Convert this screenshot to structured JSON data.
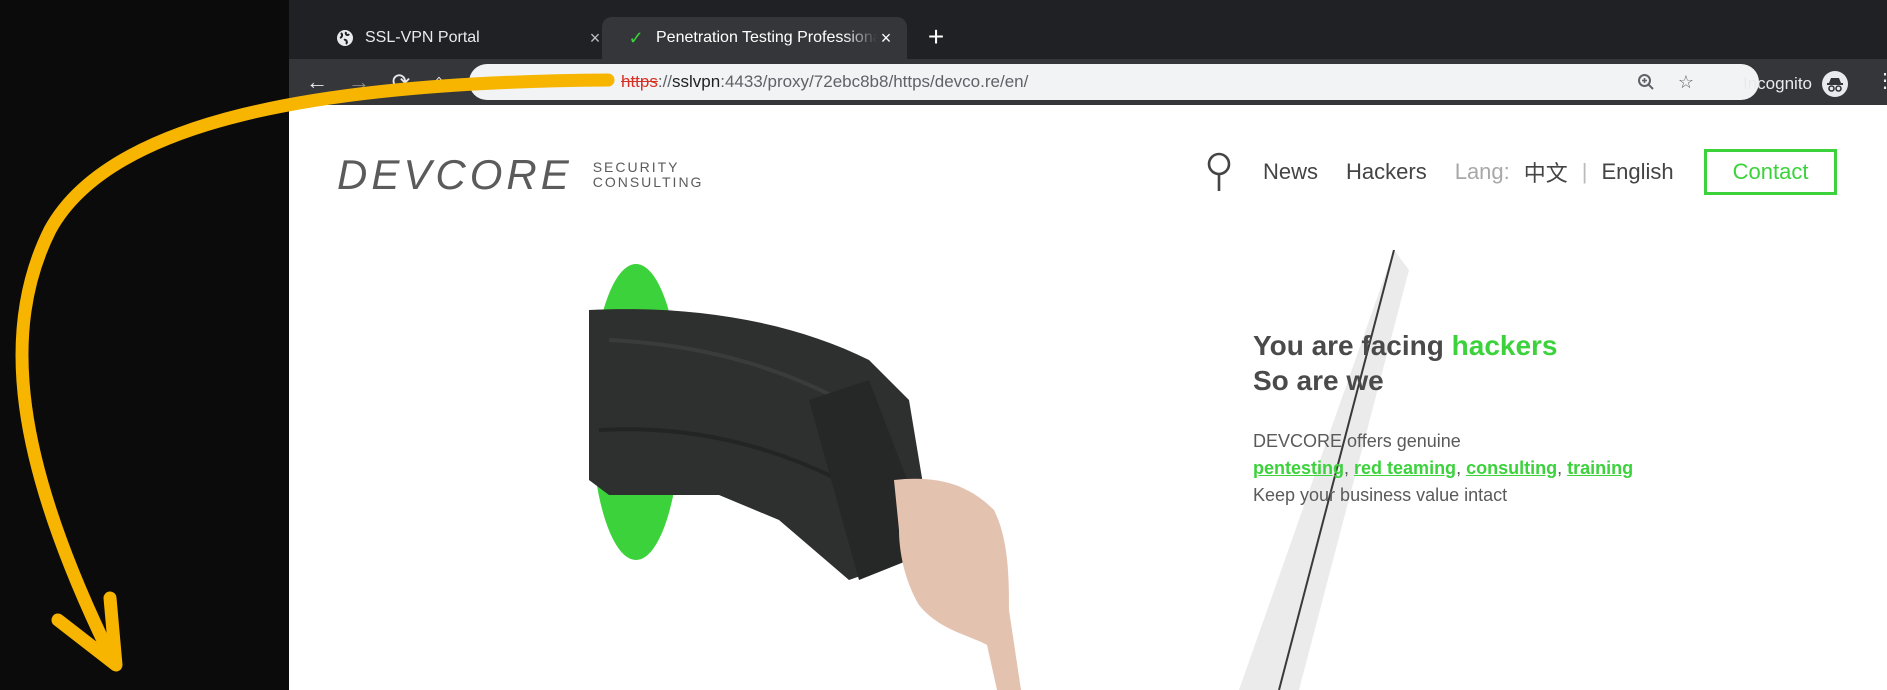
{
  "browser": {
    "tabs": [
      {
        "title": "SSL-VPN Portal",
        "icon": "globe-icon",
        "active": false
      },
      {
        "title": "Penetration Testing Professional",
        "icon": "check-icon",
        "active": true
      }
    ],
    "url": {
      "scheme": "https",
      "separator": "://",
      "host": "sslvpn",
      "port": ":4433",
      "path": "/proxy/72ebc8b8/https/devco.re/en/"
    },
    "incognito_label": "Incognito"
  },
  "site": {
    "logo": {
      "wordmark": "DEVCORE",
      "tagline_1": "SECURITY",
      "tagline_2": "CONSULTING"
    },
    "nav": {
      "news": "News",
      "hackers": "Hackers",
      "lang_label": "Lang:",
      "lang_zh": "中文",
      "lang_sep": "|",
      "lang_en": "English",
      "contact": "Contact"
    },
    "hero": {
      "heading_1_prefix": "You are facing ",
      "heading_1_accent": "hackers",
      "heading_2": "So are we",
      "body_1": "DEVCORE offers genuine",
      "services": [
        "pentesting",
        "red teaming",
        "consulting",
        "training"
      ],
      "body_3": "Keep your business value intact"
    }
  },
  "colors": {
    "accent": "#3cd23c",
    "arrow": "#f7b500",
    "tab_strip": "#202124",
    "toolbar": "#35363a"
  }
}
